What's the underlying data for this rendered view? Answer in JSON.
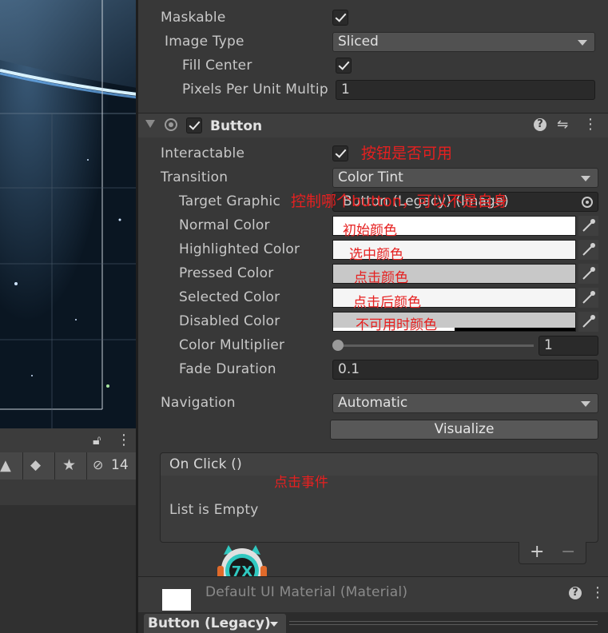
{
  "image_settings": {
    "maskable_label": "Maskable",
    "image_type_label": "Image Type",
    "image_type_value": "Sliced",
    "fill_center_label": "Fill Center",
    "pixels_per_unit_label": "Pixels Per Unit Multip",
    "pixels_per_unit_value": "1"
  },
  "component": {
    "title": "Button"
  },
  "fields": {
    "interactable_label": "Interactable",
    "transition_label": "Transition",
    "transition_value": "Color Tint",
    "target_graphic_label": "Target Graphic",
    "target_graphic_value": "Button (Legacy) (Image)",
    "normal_color_label": "Normal Color",
    "highlighted_color_label": "Highlighted Color",
    "pressed_color_label": "Pressed Color",
    "selected_color_label": "Selected Color",
    "disabled_color_label": "Disabled Color",
    "color_multiplier_label": "Color Multiplier",
    "color_multiplier_value": "1",
    "color_multiplier_slider": 0,
    "fade_duration_label": "Fade Duration",
    "fade_duration_value": "0.1",
    "navigation_label": "Navigation",
    "navigation_value": "Automatic",
    "visualize_label": "Visualize"
  },
  "colors": {
    "normal": "#ffffff",
    "highlighted": "#f5f5f5",
    "pressed": "#c8c8c8",
    "selected": "#f5f5f5",
    "disabled": "#c8c8c8"
  },
  "onclick": {
    "title": "On Click ()",
    "empty_text": "List is Empty",
    "add_symbol": "+",
    "remove_symbol": "−"
  },
  "annotations": {
    "interactable_note": "按钮是否可用",
    "target_graphic_note": "控制哪个button，可以不是自身",
    "normal_note": "初始颜色",
    "highlighted_note": "选中颜色",
    "pressed_note": "点击颜色",
    "selected_note": "点击后颜色",
    "disabled_note": "不可用时颜色",
    "onclick_note": "点击事件"
  },
  "material": {
    "name": "Default UI Material (Material)"
  },
  "footer": {
    "dropdown_label": "Button (Legacy)"
  },
  "left_panel": {
    "hidden_count": "14"
  }
}
